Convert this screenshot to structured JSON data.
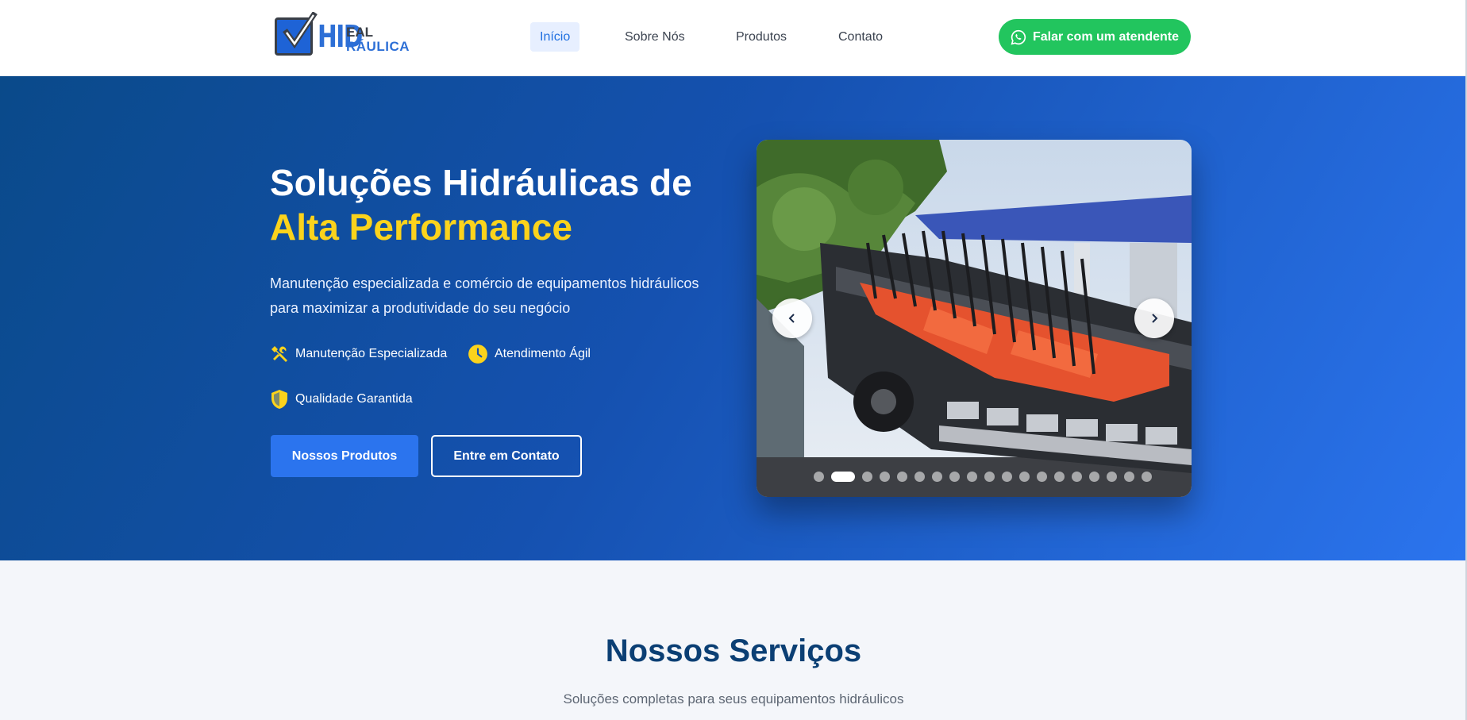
{
  "brand": {
    "logo_hid": "HID",
    "logo_eal": "EAL",
    "logo_raulica": "RÁULICA",
    "logo_icon": "checkmark-box-icon"
  },
  "nav": {
    "items": [
      {
        "label": "Início",
        "active": true
      },
      {
        "label": "Sobre Nós",
        "active": false
      },
      {
        "label": "Produtos",
        "active": false
      },
      {
        "label": "Contato",
        "active": false
      }
    ],
    "cta_label": "Falar com um atendente",
    "cta_icon": "whatsapp-icon"
  },
  "hero": {
    "title_line1": "Soluções Hidráulicas de",
    "title_line2": "Alta Performance",
    "subtitle": "Manutenção especializada e comércio de equipamentos hidráulicos para maximizar a produtividade do seu negócio",
    "features": [
      {
        "icon": "tools-icon",
        "label": "Manutenção Especializada"
      },
      {
        "icon": "clock-icon",
        "label": "Atendimento Ágil"
      },
      {
        "icon": "shield-icon",
        "label": "Qualidade Garantida"
      }
    ],
    "primary_button": "Nossos Produtos",
    "secondary_button": "Entre em Contato"
  },
  "carousel": {
    "prev_icon": "chevron-left-icon",
    "next_icon": "chevron-right-icon",
    "slide_count": 19,
    "active_index": 1
  },
  "services": {
    "title": "Nossos Serviços",
    "subtitle": "Soluções completas para seus equipamentos hidráulicos"
  },
  "colors": {
    "accent_blue": "#2b74ee",
    "highlight_yellow": "#fbd31c",
    "whatsapp_green": "#22c55e",
    "heading_navy": "#0b3f74"
  }
}
